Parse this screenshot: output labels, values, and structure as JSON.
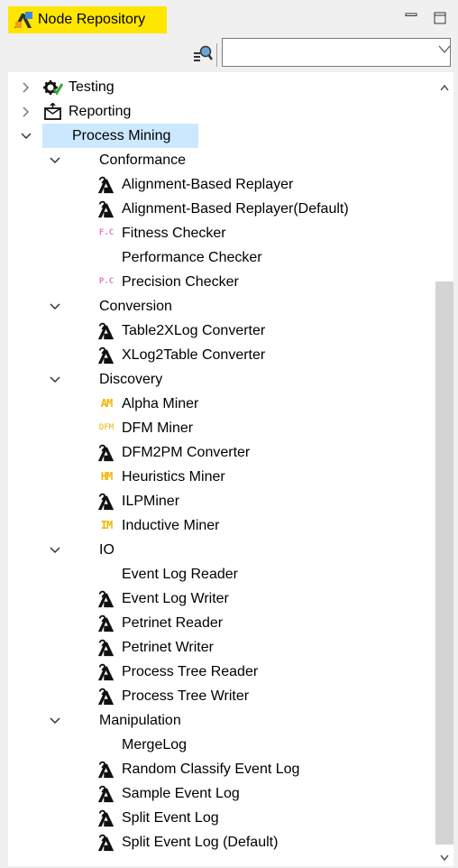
{
  "window": {
    "title": "Node Repository"
  },
  "icons": {
    "node_repository": "node-repository-icon",
    "minimize": "minimize-icon",
    "maximize": "maximize-icon",
    "filter": "filter-icon",
    "view_menu": "chevron-down-icon",
    "node": "node-icon"
  },
  "colors": {
    "title_highlight": "#ffe600",
    "selection": "#cce8ff",
    "scroll_thumb": "#d4d4d4"
  },
  "search": {
    "value": "",
    "placeholder": ""
  },
  "tree": {
    "testing": "Testing",
    "reporting": "Reporting",
    "process_mining": "Process Mining",
    "conformance": {
      "label": "Conformance",
      "items": [
        "Alignment-Based Replayer",
        "Alignment-Based Replayer(Default)",
        "Fitness Checker",
        "Performance Checker",
        "Precision Checker"
      ]
    },
    "conversion": {
      "label": "Conversion",
      "items": [
        "Table2XLog Converter",
        "XLog2Table Converter"
      ]
    },
    "discovery": {
      "label": "Discovery",
      "items": [
        "Alpha Miner",
        "DFM Miner",
        "DFM2PM Converter",
        "Heuristics Miner",
        "ILPMiner",
        "Inductive Miner"
      ],
      "icon_text": {
        "alpha": "AM",
        "dfm": "DFM",
        "heuristics": "HM",
        "inductive": "IM"
      }
    },
    "io": {
      "label": "IO",
      "items": [
        "Event Log Reader",
        "Event Log Writer",
        "Petrinet Reader",
        "Petrinet Writer",
        "Process Tree Reader",
        "Process Tree Writer"
      ]
    },
    "manipulation": {
      "label": "Manipulation",
      "items": [
        "MergeLog",
        "Random Classify Event Log",
        "Sample Event Log",
        "Split Event Log",
        "Split Event Log (Default)"
      ]
    },
    "checker_icon_text": {
      "fitness": "F.C",
      "precision": "P.C"
    }
  }
}
